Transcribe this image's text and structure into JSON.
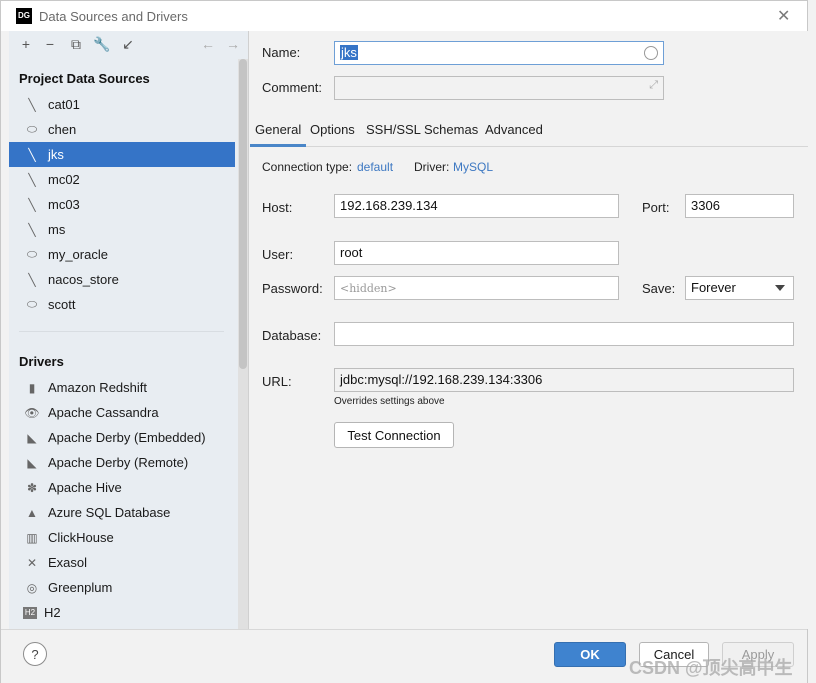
{
  "window": {
    "title": "Data Sources and Drivers",
    "app_icon_text": "DG"
  },
  "project": {
    "header": "Project Data Sources",
    "items": [
      {
        "label": "cat01",
        "icon": "dolphin-icon"
      },
      {
        "label": "chen",
        "icon": "oracle-icon"
      },
      {
        "label": "jks",
        "icon": "dolphin-icon",
        "selected": true
      },
      {
        "label": "mc02",
        "icon": "dolphin-icon"
      },
      {
        "label": "mc03",
        "icon": "dolphin-icon"
      },
      {
        "label": "ms",
        "icon": "dolphin-icon"
      },
      {
        "label": "my_oracle",
        "icon": "oracle-icon"
      },
      {
        "label": "nacos_store",
        "icon": "dolphin-icon"
      },
      {
        "label": "scott",
        "icon": "oracle-icon"
      }
    ]
  },
  "drivers": {
    "header": "Drivers",
    "items": [
      {
        "label": "Amazon Redshift"
      },
      {
        "label": "Apache Cassandra"
      },
      {
        "label": "Apache Derby (Embedded)"
      },
      {
        "label": "Apache Derby (Remote)"
      },
      {
        "label": "Apache Hive"
      },
      {
        "label": "Azure SQL Database"
      },
      {
        "label": "ClickHouse"
      },
      {
        "label": "Exasol"
      },
      {
        "label": "Greenplum"
      },
      {
        "label": "H2"
      }
    ]
  },
  "form": {
    "name_label": "Name:",
    "name_value": "jks",
    "comment_label": "Comment:",
    "tabs": [
      "General",
      "Options",
      "SSH/SSL",
      "Schemas",
      "Advanced"
    ],
    "conn_type_label": "Connection type:",
    "conn_type_value": "default",
    "driver_label": "Driver:",
    "driver_value": "MySQL",
    "host_label": "Host:",
    "host_value": "192.168.239.134",
    "port_label": "Port:",
    "port_value": "3306",
    "user_label": "User:",
    "user_value": "root",
    "password_label": "Password:",
    "password_placeholder": "<hidden>",
    "save_label": "Save:",
    "save_value": "Forever",
    "database_label": "Database:",
    "database_value": "",
    "url_label": "URL:",
    "url_value": "jdbc:mysql://192.168.239.134:3306",
    "url_hint": "Overrides settings above",
    "test_button": "Test Connection"
  },
  "footer": {
    "help": "?",
    "ok": "OK",
    "cancel": "Cancel",
    "apply": "Apply",
    "watermark": "CSDN @顶尖高中生"
  }
}
